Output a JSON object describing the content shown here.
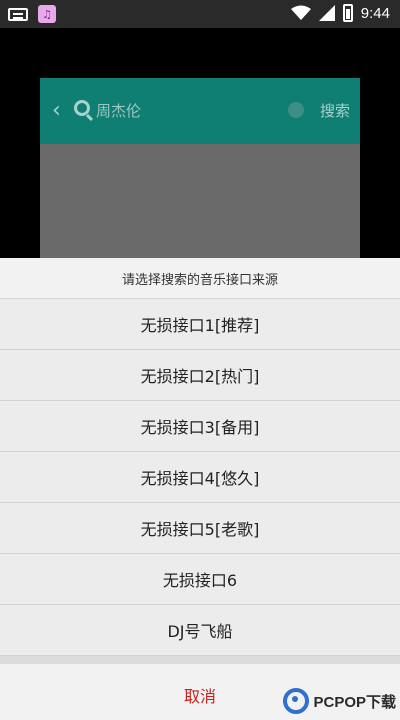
{
  "status_bar": {
    "time": "9:44",
    "app_icon_text": "♫"
  },
  "preview": {
    "search_query": "周杰伦",
    "search_button": "搜索"
  },
  "sheet": {
    "title": "请选择搜索的音乐接口来源",
    "options": [
      "无损接口1[推荐]",
      "无损接口2[热门]",
      "无损接口3[备用]",
      "无损接口4[悠久]",
      "无损接口5[老歌]",
      "无损接口6",
      "DJ号飞船"
    ],
    "cancel": "取消"
  },
  "watermark": "PCPOP下载",
  "colors": {
    "accent": "#0f7f74",
    "cancel": "#c8201c",
    "sheet_bg": "#ececec"
  }
}
